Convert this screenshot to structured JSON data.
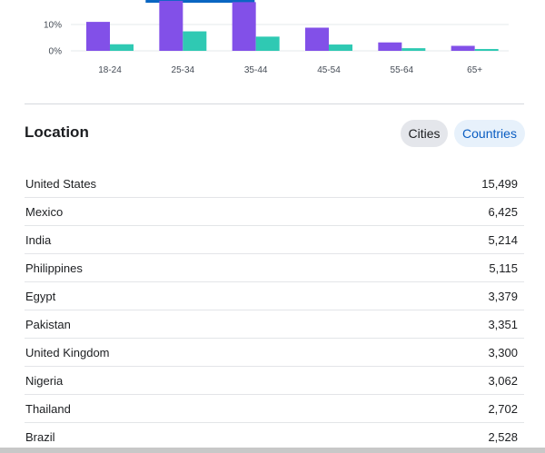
{
  "age_chart": {
    "chart_data": {
      "type": "bar",
      "categories": [
        "18-24",
        "25-34",
        "35-44",
        "45-54",
        "55-64",
        "65+"
      ],
      "series": [
        {
          "values": [
            11.0,
            19.0,
            18.5,
            8.8,
            3.2,
            1.9
          ]
        },
        {
          "values": [
            2.5,
            7.4,
            5.4,
            2.4,
            1.0,
            0.7
          ]
        }
      ],
      "yticks": [
        "10%",
        "0%"
      ],
      "ylim": [
        0,
        20
      ]
    },
    "colors": {
      "series_a": "#8250e8",
      "series_b": "#2fc9b3",
      "selected_tab": "#0a66c2"
    }
  },
  "location": {
    "title": "Location",
    "filters": {
      "cities_label": "Cities",
      "countries_label": "Countries",
      "selected": "Countries"
    },
    "rows": [
      {
        "name": "United States",
        "value": "15,499"
      },
      {
        "name": "Mexico",
        "value": "6,425"
      },
      {
        "name": "India",
        "value": "5,214"
      },
      {
        "name": "Philippines",
        "value": "5,115"
      },
      {
        "name": "Egypt",
        "value": "3,379"
      },
      {
        "name": "Pakistan",
        "value": "3,351"
      },
      {
        "name": "United Kingdom",
        "value": "3,300"
      },
      {
        "name": "Nigeria",
        "value": "3,062"
      },
      {
        "name": "Thailand",
        "value": "2,702"
      },
      {
        "name": "Brazil",
        "value": "2,528"
      }
    ]
  }
}
